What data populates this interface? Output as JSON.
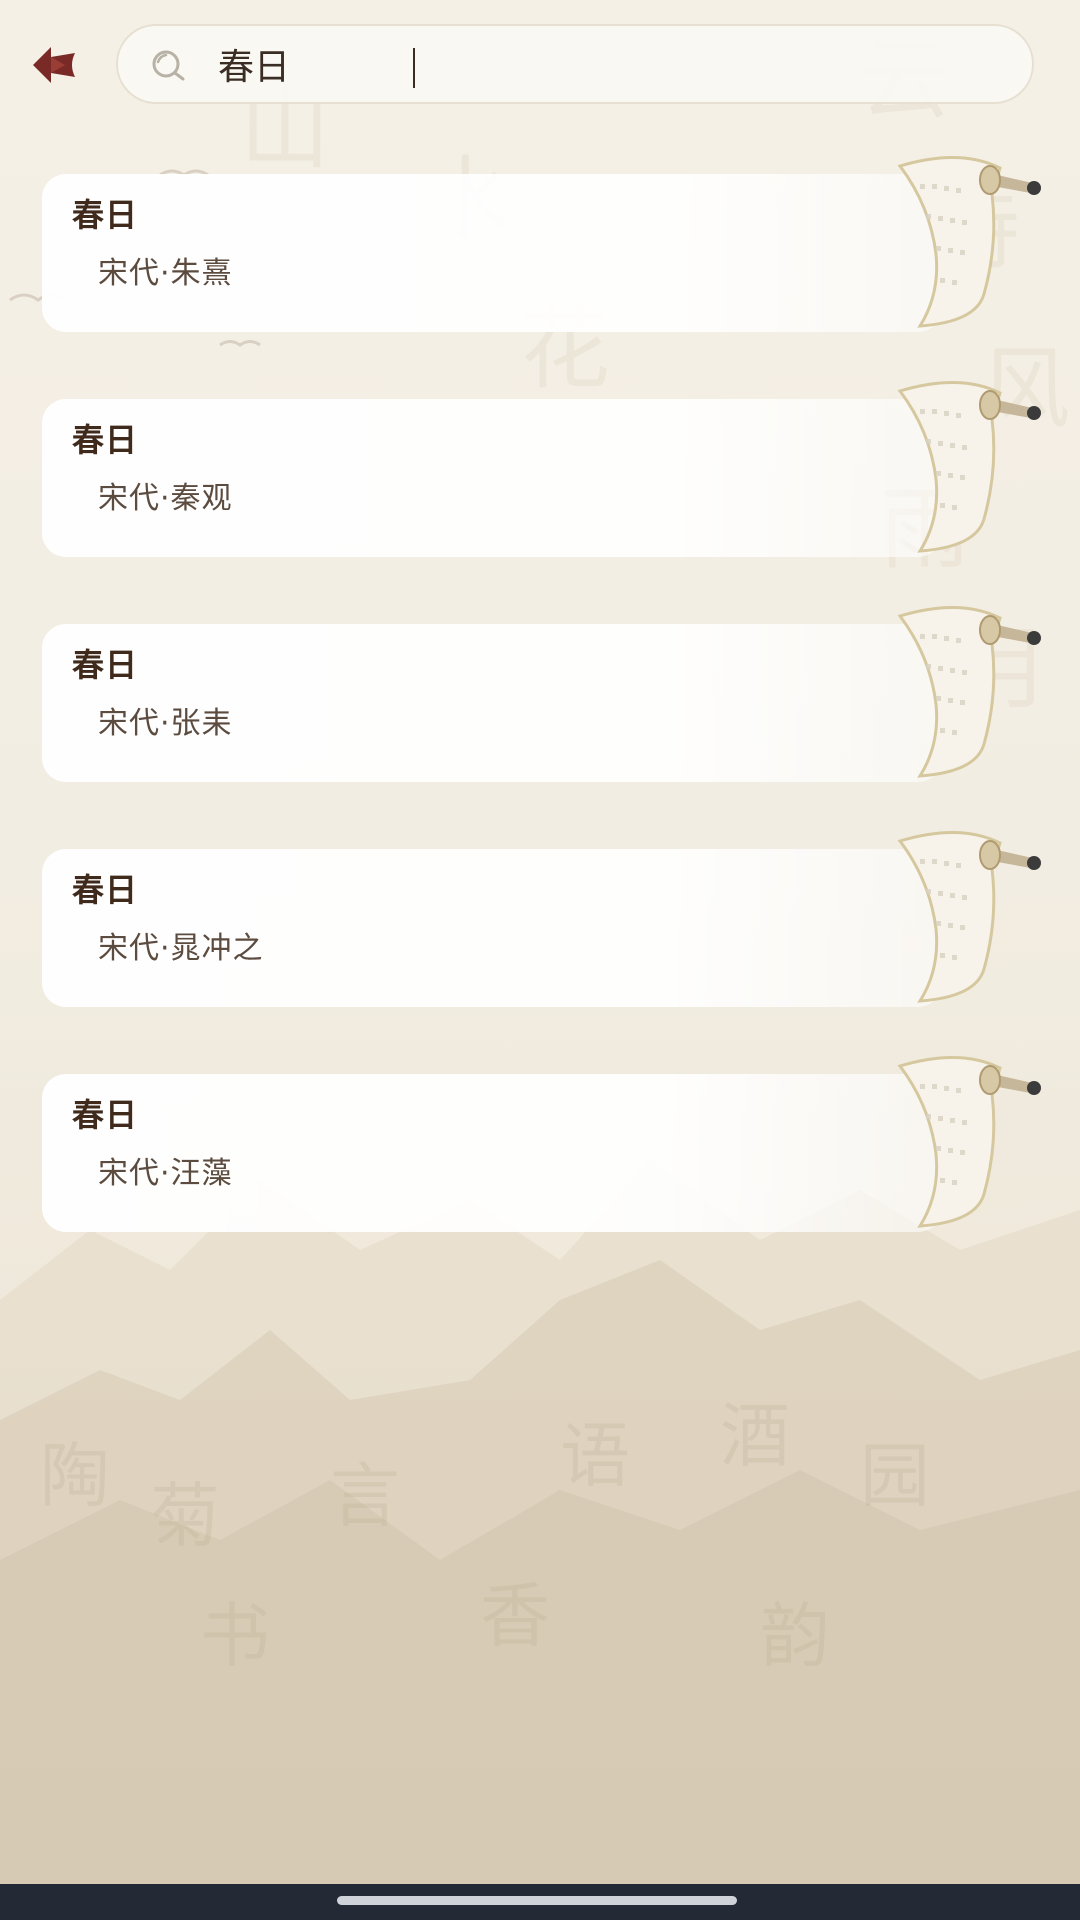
{
  "search": {
    "query": "春日",
    "icon": "search-icon"
  },
  "header": {
    "back_icon": "back-arrow-icon"
  },
  "results": [
    {
      "title": "春日",
      "meta": "宋代·朱熹"
    },
    {
      "title": "春日",
      "meta": "宋代·秦观"
    },
    {
      "title": "春日",
      "meta": "宋代·张耒"
    },
    {
      "title": "春日",
      "meta": "宋代·晁冲之"
    },
    {
      "title": "春日",
      "meta": "宋代·汪藻"
    }
  ],
  "colors": {
    "accent": "#7a2a26",
    "title_text": "#3f2a1c",
    "meta_text": "#5c4b3f",
    "background": "#f3eee4",
    "nav_bar": "#232a36"
  }
}
